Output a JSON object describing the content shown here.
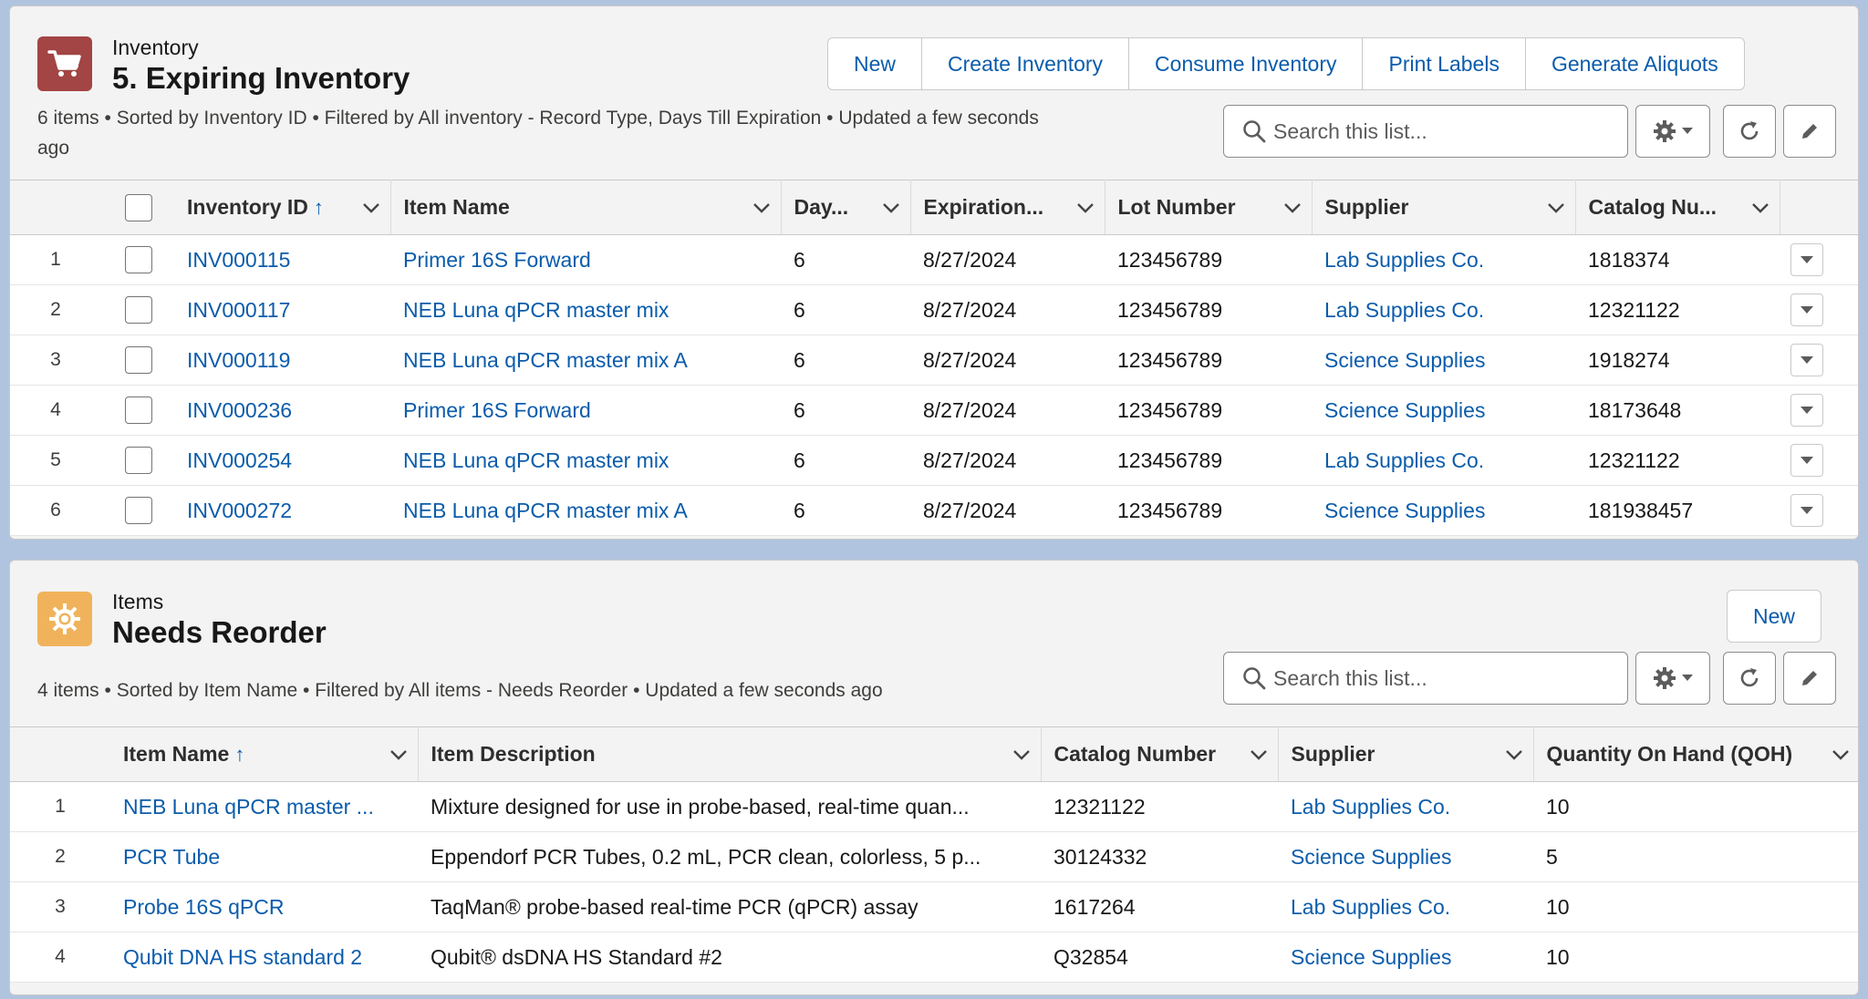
{
  "inventory_list": {
    "object_label": "Inventory",
    "title": "5. Expiring Inventory",
    "meta_line1": "6 items • Sorted by Inventory ID • Filtered by All inventory - Record Type, Days Till Expiration • Updated a few seconds",
    "meta_line2": "ago",
    "icon": "shopping-cart-icon",
    "icon_color": "#a24544",
    "buttons": [
      "New",
      "Create Inventory",
      "Consume Inventory",
      "Print Labels",
      "Generate Aliquots"
    ],
    "search_placeholder": "Search this list...",
    "columns": [
      "Inventory ID",
      "Item Name",
      "Day...",
      "Expiration...",
      "Lot Number",
      "Supplier",
      "Catalog Nu..."
    ],
    "rows": [
      {
        "n": "1",
        "id": "INV000115",
        "item": "Primer 16S Forward",
        "days": "6",
        "exp": "8/27/2024",
        "lot": "123456789",
        "supplier": "Lab Supplies Co.",
        "catalog": "1818374"
      },
      {
        "n": "2",
        "id": "INV000117",
        "item": "NEB Luna qPCR master mix",
        "days": "6",
        "exp": "8/27/2024",
        "lot": "123456789",
        "supplier": "Lab Supplies Co.",
        "catalog": "12321122"
      },
      {
        "n": "3",
        "id": "INV000119",
        "item": "NEB Luna qPCR master mix A",
        "days": "6",
        "exp": "8/27/2024",
        "lot": "123456789",
        "supplier": "Science Supplies",
        "catalog": "1918274"
      },
      {
        "n": "4",
        "id": "INV000236",
        "item": "Primer 16S Forward",
        "days": "6",
        "exp": "8/27/2024",
        "lot": "123456789",
        "supplier": "Science Supplies",
        "catalog": "18173648"
      },
      {
        "n": "5",
        "id": "INV000254",
        "item": "NEB Luna qPCR master mix",
        "days": "6",
        "exp": "8/27/2024",
        "lot": "123456789",
        "supplier": "Lab Supplies Co.",
        "catalog": "12321122"
      },
      {
        "n": "6",
        "id": "INV000272",
        "item": "NEB Luna qPCR master mix A",
        "days": "6",
        "exp": "8/27/2024",
        "lot": "123456789",
        "supplier": "Science Supplies",
        "catalog": "181938457"
      }
    ]
  },
  "items_list": {
    "object_label": "Items",
    "title": "Needs Reorder",
    "meta": "4 items • Sorted by Item Name • Filtered by All items - Needs Reorder • Updated a few seconds ago",
    "icon": "gear-sun-icon",
    "icon_color": "#f0b35b",
    "button_new": "New",
    "search_placeholder": "Search this list...",
    "columns": [
      "Item Name",
      "Item Description",
      "Catalog Number",
      "Supplier",
      "Quantity On Hand (QOH)"
    ],
    "rows": [
      {
        "n": "1",
        "name": "NEB Luna qPCR master ...",
        "desc": "Mixture designed for use in probe-based, real-time quan...",
        "catalog": "12321122",
        "supplier": "Lab Supplies Co.",
        "qoh": "10"
      },
      {
        "n": "2",
        "name": "PCR Tube",
        "desc": "Eppendorf PCR Tubes, 0.2 mL, PCR clean, colorless, 5 p...",
        "catalog": "30124332",
        "supplier": "Science Supplies",
        "qoh": "5"
      },
      {
        "n": "3",
        "name": "Probe 16S qPCR",
        "desc": "TaqMan® probe-based real-time PCR (qPCR) assay",
        "catalog": "1617264",
        "supplier": "Lab Supplies Co.",
        "qoh": "10"
      },
      {
        "n": "4",
        "name": "Qubit DNA HS standard 2",
        "desc": "Qubit® dsDNA HS Standard #2",
        "catalog": "Q32854",
        "supplier": "Science Supplies",
        "qoh": "10"
      }
    ]
  }
}
